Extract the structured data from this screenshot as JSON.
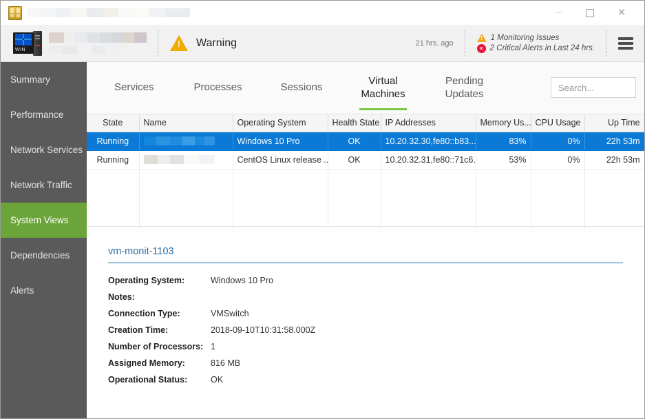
{
  "window": {
    "title_redacted": true,
    "app_icon": "spreadsheet-icon",
    "controls": {
      "minimize": "minimize-icon",
      "maximize": "maximize-icon",
      "close": "close-icon"
    }
  },
  "header": {
    "device_icon": "windows-server-icon",
    "device_icon_label": "WIN",
    "device_name_redacted": true,
    "status": "Warning",
    "status_icon": "warning-triangle-icon",
    "time_ago": "21 hrs. ago",
    "alerts": [
      {
        "icon": "warning-triangle-icon",
        "text": "1 Monitoring Issues"
      },
      {
        "icon": "critical-circle-icon",
        "text": "2 Critical Alerts in Last 24 hrs."
      }
    ],
    "menu_icon": "hamburger-menu-icon"
  },
  "sidebar": {
    "items": [
      {
        "label": "Summary",
        "active": false
      },
      {
        "label": "Performance",
        "active": false
      },
      {
        "label": "Network Services",
        "active": false
      },
      {
        "label": "Network Traffic",
        "active": false
      },
      {
        "label": "System Views",
        "active": true
      },
      {
        "label": "Dependencies",
        "active": false
      },
      {
        "label": "Alerts",
        "active": false
      }
    ]
  },
  "tabs": [
    {
      "label": "Services",
      "active": false
    },
    {
      "label": "Processes",
      "active": false
    },
    {
      "label": "Sessions",
      "active": false
    },
    {
      "label": "Virtual Machines",
      "line1": "Virtual",
      "line2": "Machines",
      "active": true
    },
    {
      "label": "Pending Updates",
      "line1": "Pending",
      "line2": "Updates",
      "active": false
    }
  ],
  "search": {
    "placeholder": "Search...",
    "value": ""
  },
  "table": {
    "columns": [
      "State",
      "Name",
      "Operating System",
      "Health State",
      "IP Addresses",
      "Memory Us...",
      "CPU Usage",
      "Up Time"
    ],
    "rows": [
      {
        "selected": true,
        "state": "Running",
        "name_redacted": true,
        "os": "Windows 10 Pro",
        "health": "OK",
        "ip": "10.20.32.30,fe80::b83...",
        "memory": "83%",
        "cpu": "0%",
        "uptime": "22h 53m"
      },
      {
        "selected": false,
        "state": "Running",
        "name_redacted": true,
        "os": "CentOS Linux release ...",
        "health": "OK",
        "ip": "10.20.32.31,fe80::71c6...",
        "memory": "53%",
        "cpu": "0%",
        "uptime": "22h 53m"
      }
    ]
  },
  "details": {
    "title": "vm-monit-1103",
    "fields": [
      {
        "label": "Operating System:",
        "value": "Windows 10 Pro"
      },
      {
        "label": "Notes:",
        "value": ""
      },
      {
        "label": "Connection Type:",
        "value": "VMSwitch"
      },
      {
        "label": "Creation Time:",
        "value": "2018-09-10T10:31:58.000Z"
      },
      {
        "label": "Number of Processors:",
        "value": "1"
      },
      {
        "label": "Assigned Memory:",
        "value": "816 MB"
      },
      {
        "label": "Operational Status:",
        "value": "OK"
      }
    ]
  },
  "colors": {
    "accent_green": "#6ba539",
    "tab_underline": "#7ac943",
    "selection_blue": "#0a7ad6",
    "warning_amber": "#f0ab00",
    "critical_red": "#e8143c",
    "sidebar_gray": "#5a5a5a",
    "detail_link": "#2e6fa3"
  }
}
